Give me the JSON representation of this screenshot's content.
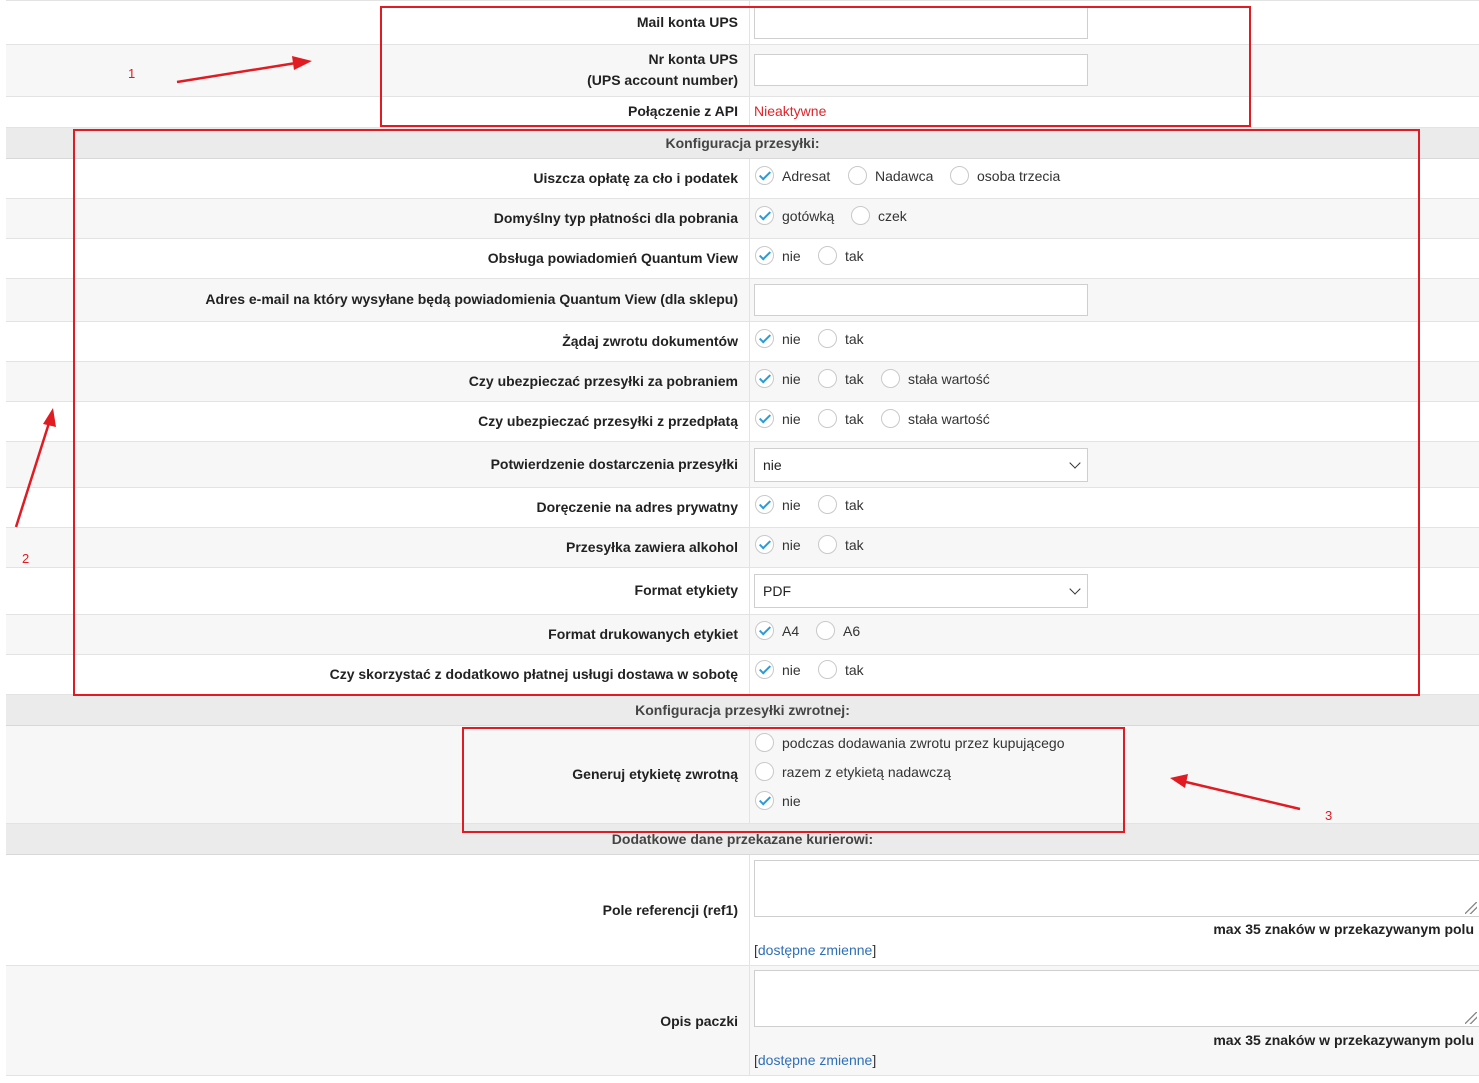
{
  "ups": {
    "mail_label": "Mail konta UPS",
    "mail_value": "",
    "account_label_1": "Nr konta UPS",
    "account_label_2": "(UPS account number)",
    "account_value": "",
    "api_label": "Połączenie z API",
    "api_status": "Nieaktywne"
  },
  "shipment": {
    "header": "Konfiguracja przesyłki:",
    "duty": {
      "label": "Uiszcza opłatę za cło i podatek",
      "options": [
        "Adresat",
        "Nadawca",
        "osoba trzecia"
      ],
      "selected": "Adresat"
    },
    "cod_payment": {
      "label": "Domyślny typ płatności dla pobrania",
      "options": [
        "gotówką",
        "czek"
      ],
      "selected": "gotówką"
    },
    "quantum": {
      "label": "Obsługa powiadomień Quantum View",
      "options": [
        "nie",
        "tak"
      ],
      "selected": "nie"
    },
    "quantum_email": {
      "label": "Adres e-mail na który wysyłane będą powiadomienia Quantum View (dla sklepu)",
      "value": ""
    },
    "return_docs": {
      "label": "Żądaj zwrotu dokumentów",
      "options": [
        "nie",
        "tak"
      ],
      "selected": "nie"
    },
    "insure_cod": {
      "label": "Czy ubezpieczać przesyłki za pobraniem",
      "options": [
        "nie",
        "tak",
        "stała wartość"
      ],
      "selected": "nie"
    },
    "insure_prepaid": {
      "label": "Czy ubezpieczać przesyłki z przedpłatą",
      "options": [
        "nie",
        "tak",
        "stała wartość"
      ],
      "selected": "nie"
    },
    "delivery_confirm": {
      "label": "Potwierdzenie dostarczenia przesyłki",
      "value": "nie"
    },
    "private_address": {
      "label": "Doręczenie na adres prywatny",
      "options": [
        "nie",
        "tak"
      ],
      "selected": "nie"
    },
    "alcohol": {
      "label": "Przesyłka zawiera alkohol",
      "options": [
        "nie",
        "tak"
      ],
      "selected": "nie"
    },
    "label_format": {
      "label": "Format etykiety",
      "value": "PDF"
    },
    "print_format": {
      "label": "Format drukowanych etykiet",
      "options": [
        "A4",
        "A6"
      ],
      "selected": "A4"
    },
    "saturday": {
      "label": "Czy skorzystać z dodatkowo płatnej usługi dostawa w sobotę",
      "options": [
        "nie",
        "tak"
      ],
      "selected": "nie"
    }
  },
  "return_shipment": {
    "header": "Konfiguracja przesyłki zwrotnej:",
    "generate": {
      "label": "Generuj etykietę zwrotną",
      "options": [
        "podczas dodawania zwrotu przez kupującego",
        "razem z etykietą nadawczą",
        "nie"
      ],
      "selected": "nie"
    }
  },
  "courier": {
    "header": "Dodatkowe dane przekazane kurierowi:",
    "ref1": {
      "label": "Pole referencji (ref1)",
      "value": "",
      "hint": "max 35 znaków w przekazywanym polu",
      "vars_open": "[",
      "vars_link": "dostępne zmienne",
      "vars_close": "]"
    },
    "description": {
      "label": "Opis paczki",
      "value": "",
      "hint": "max 35 znaków w przekazywanym polu",
      "vars_open": "[",
      "vars_link": "dostępne zmienne",
      "vars_close": "]"
    }
  },
  "annotations": {
    "n1": "1",
    "n2": "2",
    "n3": "3",
    "color": "#e01b22"
  },
  "colors": {
    "selected_check": "#2b9bd8",
    "link": "#2d6fb8",
    "inactive_status": "#e0242a"
  }
}
